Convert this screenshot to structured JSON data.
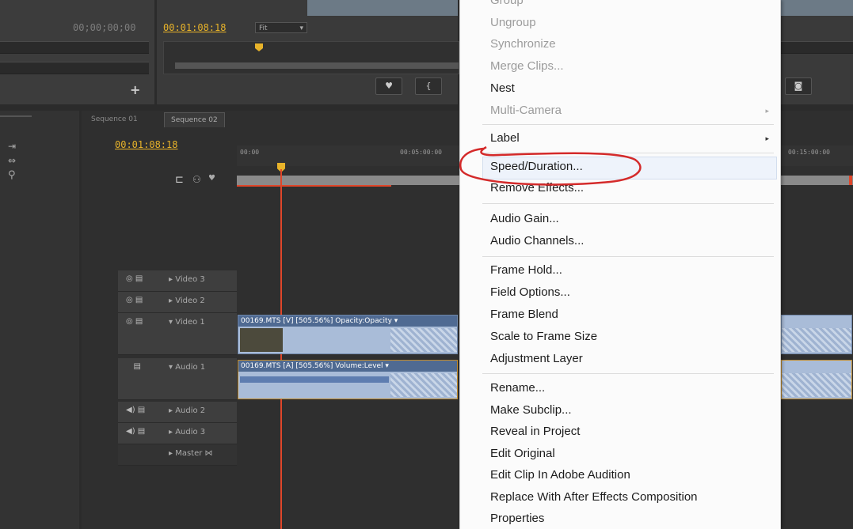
{
  "source_monitor": {
    "timecode": "00;00;00;00"
  },
  "program_monitor": {
    "timecode": "00:01:08:18",
    "fit_label": "Fit"
  },
  "buttons": {
    "add": "+",
    "marker": "♥",
    "in_point": "{",
    "camera": "◙"
  },
  "timeline": {
    "tabs": [
      "Sequence 01",
      "Sequence 02"
    ],
    "timecode": "00:01:08:18",
    "ruler_ticks": [
      "00:00",
      "00:05:00:00",
      "00:15:00:00"
    ],
    "tracks": [
      {
        "name": "Video 3"
      },
      {
        "name": "Video 2"
      },
      {
        "name": "Video 1"
      },
      {
        "name": "Audio 1"
      },
      {
        "name": "Audio 2"
      },
      {
        "name": "Audio 3"
      },
      {
        "name": "Master"
      }
    ],
    "clips": {
      "video_label": "00169.MTS [V] [505.56%]  Opacity:Opacity ▾",
      "audio_label": "00169.MTS [A] [505.56%]  Volume:Level ▾"
    }
  },
  "context_menu": {
    "items": [
      {
        "label": "Group",
        "enabled": false
      },
      {
        "label": "Ungroup",
        "enabled": false
      },
      {
        "label": "Synchronize",
        "enabled": false
      },
      {
        "label": "Merge Clips...",
        "enabled": false
      },
      {
        "label": "Nest",
        "enabled": true
      },
      {
        "label": "Multi-Camera",
        "enabled": false,
        "submenu": true
      },
      {
        "label": "Label",
        "enabled": true,
        "submenu": true
      },
      {
        "label": "Speed/Duration...",
        "enabled": true,
        "highlighted": true
      },
      {
        "label": "Remove Effects...",
        "enabled": true
      },
      {
        "label": "Audio Gain...",
        "enabled": true
      },
      {
        "label": "Audio Channels...",
        "enabled": true
      },
      {
        "label": "Frame Hold...",
        "enabled": true
      },
      {
        "label": "Field Options...",
        "enabled": true
      },
      {
        "label": "Frame Blend",
        "enabled": true
      },
      {
        "label": "Scale to Frame Size",
        "enabled": true
      },
      {
        "label": "Adjustment Layer",
        "enabled": true
      },
      {
        "label": "Rename...",
        "enabled": true
      },
      {
        "label": "Make Subclip...",
        "enabled": true
      },
      {
        "label": "Reveal in Project",
        "enabled": true
      },
      {
        "label": "Edit Original",
        "enabled": true
      },
      {
        "label": "Edit Clip In Adobe Audition",
        "enabled": true
      },
      {
        "label": "Replace With After Effects Composition",
        "enabled": true
      },
      {
        "label": "Properties",
        "enabled": true
      }
    ]
  },
  "colors": {
    "timecode": "#e8b32a",
    "playhead": "#e0462a",
    "annotation": "#d42a2a",
    "clip": "#a9bcd8"
  }
}
